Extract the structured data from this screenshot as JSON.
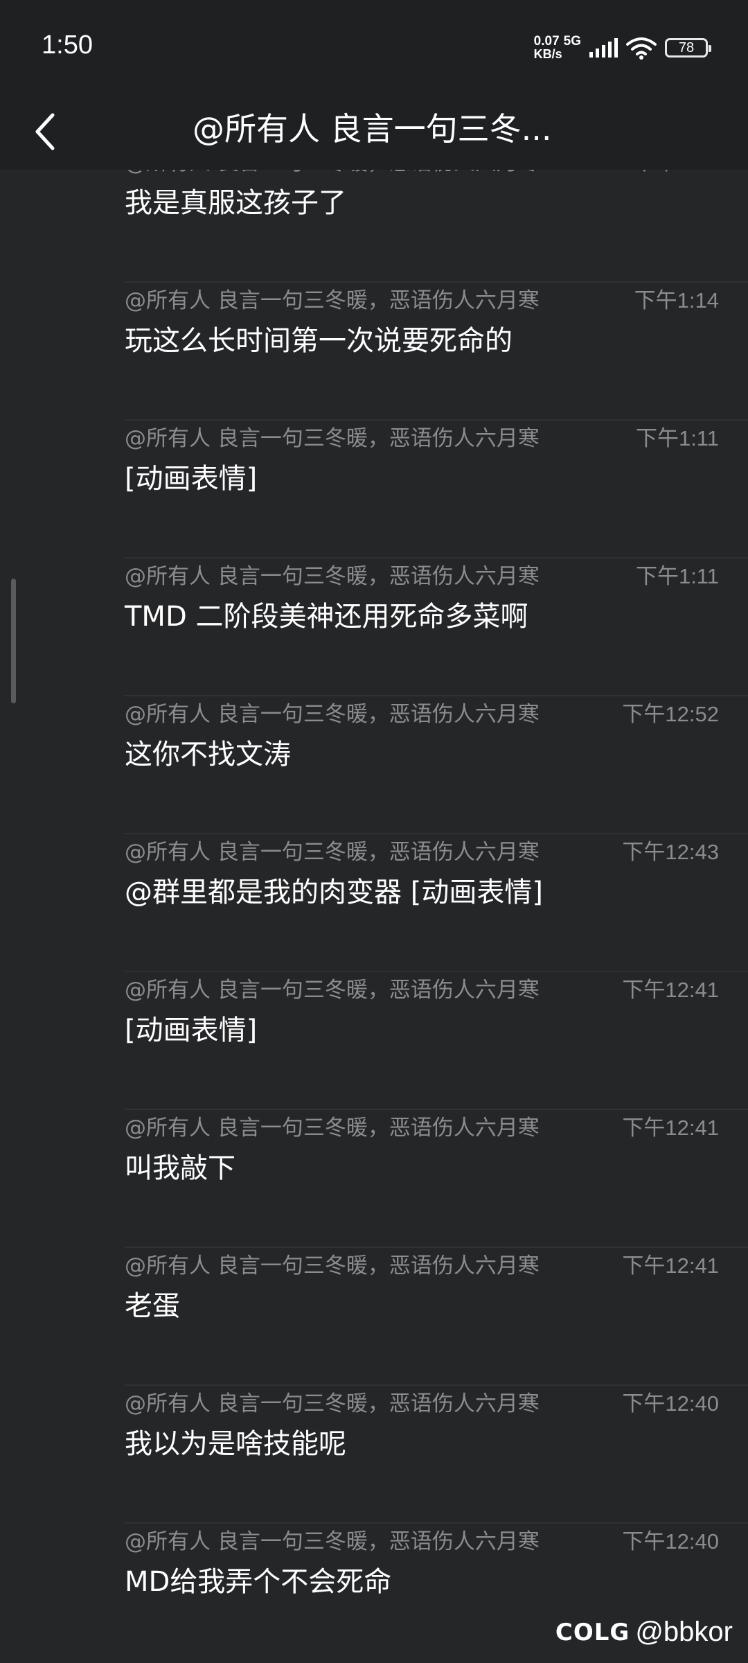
{
  "status_bar": {
    "time": "1:50",
    "net_speed_value": "0.07",
    "net_type": "5G",
    "net_speed_unit": "KB/s",
    "battery": "78",
    "icons": [
      "signal-icon",
      "wifi-icon",
      "battery-icon"
    ]
  },
  "nav": {
    "back_icon": "chevron-left-icon",
    "title": "@所有人  良言一句三冬..."
  },
  "messages": [
    {
      "sender": "@所有人  良言一句三冬暖，恶语伤人六月寒",
      "time": "下午1:14",
      "content": "我是真服这孩子了"
    },
    {
      "sender": "@所有人  良言一句三冬暖，恶语伤人六月寒",
      "time": "下午1:14",
      "content": "玩这么长时间第一次说要死命的"
    },
    {
      "sender": "@所有人  良言一句三冬暖，恶语伤人六月寒",
      "time": "下午1:11",
      "content": "[动画表情]"
    },
    {
      "sender": "@所有人  良言一句三冬暖，恶语伤人六月寒",
      "time": "下午1:11",
      "content": "TMD 二阶段美神还用死命多菜啊"
    },
    {
      "sender": "@所有人  良言一句三冬暖，恶语伤人六月寒",
      "time": "下午12:52",
      "content": "这你不找文涛"
    },
    {
      "sender": "@所有人  良言一句三冬暖，恶语伤人六月寒",
      "time": "下午12:43",
      "content": "@群里都是我的肉变器 [动画表情]"
    },
    {
      "sender": "@所有人  良言一句三冬暖，恶语伤人六月寒",
      "time": "下午12:41",
      "content": "[动画表情]"
    },
    {
      "sender": "@所有人  良言一句三冬暖，恶语伤人六月寒",
      "time": "下午12:41",
      "content": "叫我敲下"
    },
    {
      "sender": "@所有人  良言一句三冬暖，恶语伤人六月寒",
      "time": "下午12:41",
      "content": "老蛋"
    },
    {
      "sender": "@所有人  良言一句三冬暖，恶语伤人六月寒",
      "time": "下午12:40",
      "content": "我以为是啥技能呢"
    },
    {
      "sender": "@所有人  良言一句三冬暖，恶语伤人六月寒",
      "time": "下午12:40",
      "content": "MD给我弄个不会死命"
    }
  ],
  "watermark": {
    "logo": "COLG",
    "handle": "@bbkor"
  }
}
